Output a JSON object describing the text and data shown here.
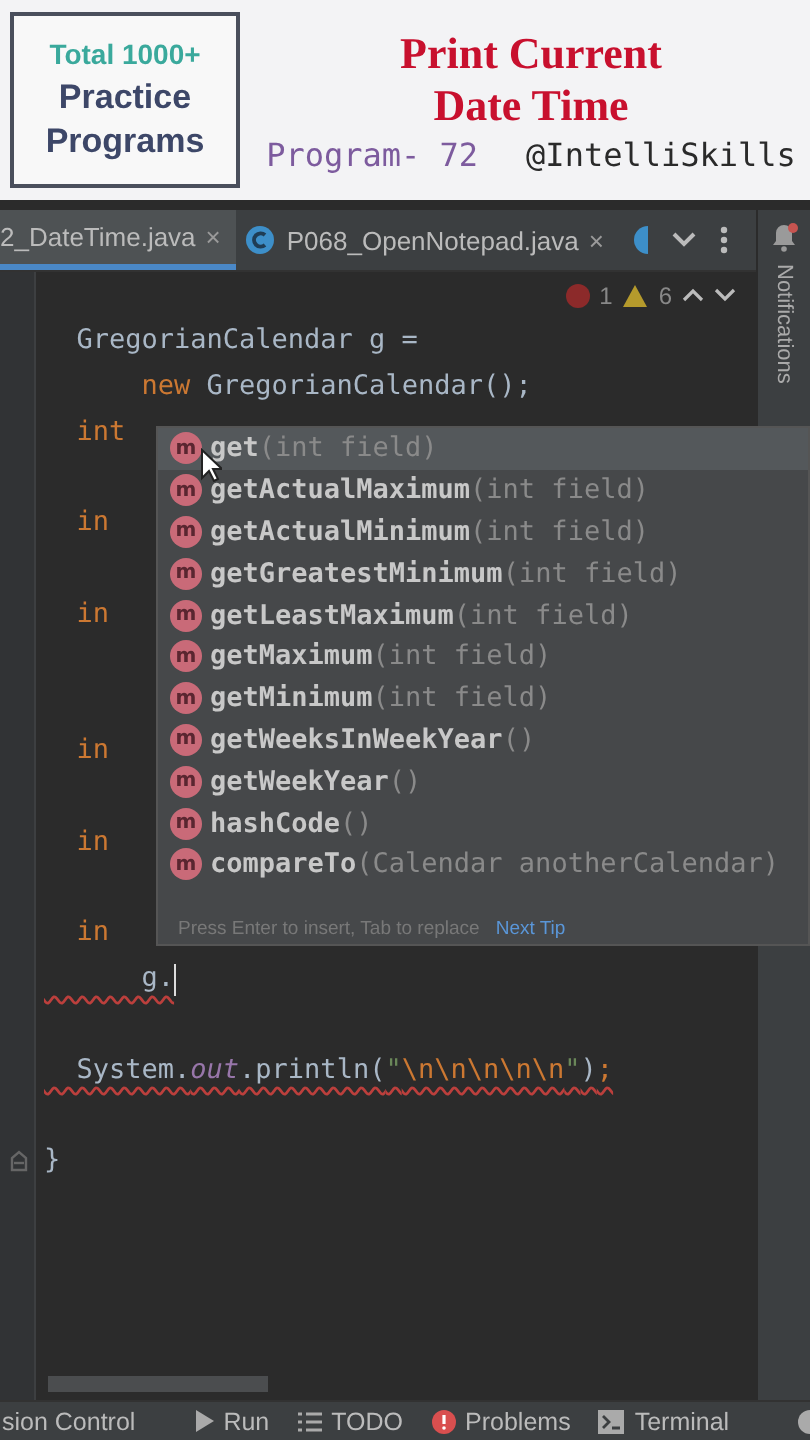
{
  "banner": {
    "box_lines": [
      "Total 1000+",
      "Practice",
      "Programs"
    ],
    "title_lines": [
      "Print Current",
      "Date Time"
    ],
    "program": "Program- 72",
    "handle": "@IntelliSkills"
  },
  "tabs": [
    {
      "label": "2_DateTime.java",
      "close": "×",
      "selected": true
    },
    {
      "label": "P068_OpenNotepad.java",
      "close": "×",
      "selected": false
    }
  ],
  "inspections": {
    "errors": "1",
    "warnings": "6"
  },
  "notifications": {
    "label": "Notifications"
  },
  "code_lines": [
    {
      "kind": "code",
      "segments": [
        {
          "kind": "plain",
          "text": "  GregorianCalendar g ="
        }
      ]
    },
    {
      "kind": "code",
      "segments": [
        {
          "kind": "keyword",
          "text": "      new"
        },
        {
          "kind": "plain",
          "text": " GregorianCalendar();"
        }
      ]
    },
    {
      "kind": "code",
      "segments": [
        {
          "kind": "keyword",
          "text": "  int"
        }
      ]
    },
    {
      "kind": "blank"
    },
    {
      "kind": "code",
      "segments": [
        {
          "kind": "keyword",
          "text": "  in"
        }
      ]
    },
    {
      "kind": "blank"
    },
    {
      "kind": "code",
      "segments": [
        {
          "kind": "keyword",
          "text": "  in"
        }
      ]
    },
    {
      "kind": "blank"
    },
    {
      "kind": "blank"
    },
    {
      "kind": "code",
      "segments": [
        {
          "kind": "keyword",
          "text": "  in"
        }
      ]
    },
    {
      "kind": "blank"
    },
    {
      "kind": "code",
      "segments": [
        {
          "kind": "keyword",
          "text": "  in"
        }
      ]
    },
    {
      "kind": "blank"
    },
    {
      "kind": "code",
      "segments": [
        {
          "kind": "keyword",
          "text": "  in"
        }
      ]
    },
    {
      "kind": "code",
      "error": true,
      "caret": true,
      "segments": [
        {
          "kind": "plain",
          "text": "      g."
        }
      ]
    },
    {
      "kind": "blank"
    },
    {
      "kind": "code",
      "error": true,
      "segments": [
        {
          "kind": "plain",
          "text": "  System."
        },
        {
          "kind": "field",
          "text": "out"
        },
        {
          "kind": "plain",
          "text": ".println("
        },
        {
          "kind": "string",
          "text": "\""
        },
        {
          "kind": "escape",
          "text": "\\n\\n\\n\\n\\n"
        },
        {
          "kind": "string",
          "text": "\""
        },
        {
          "kind": "plain",
          "text": ")"
        },
        {
          "kind": "keyword",
          "text": ";"
        }
      ]
    },
    {
      "kind": "blank"
    },
    {
      "kind": "code",
      "fold_marker": true,
      "segments": [
        {
          "kind": "plain",
          "text": "}"
        }
      ]
    }
  ],
  "completion": {
    "items": [
      {
        "icon": "m",
        "name": "get",
        "params": "(int field)",
        "selected": true
      },
      {
        "icon": "m",
        "name": "getActualMaximum",
        "params": "(int field)",
        "selected": false
      },
      {
        "icon": "m",
        "name": "getActualMinimum",
        "params": "(int field)",
        "selected": false
      },
      {
        "icon": "m",
        "name": "getGreatestMinimum",
        "params": "(int field)",
        "selected": false
      },
      {
        "icon": "m",
        "name": "getLeastMaximum",
        "params": "(int field)",
        "selected": false
      },
      {
        "icon": "m",
        "name": "getMaximum",
        "params": "(int field)",
        "selected": false
      },
      {
        "icon": "m",
        "name": "getMinimum",
        "params": "(int field)",
        "selected": false
      },
      {
        "icon": "m",
        "name": "getWeeksInWeekYear",
        "params": "()",
        "selected": false
      },
      {
        "icon": "m",
        "name": "getWeekYear",
        "params": "()",
        "selected": false
      },
      {
        "icon": "m",
        "name": "hashCode",
        "params": "()",
        "selected": false
      },
      {
        "icon": "m",
        "name": "compareTo",
        "params": "(Calendar anotherCalendar)",
        "selected": false
      }
    ],
    "hint": "Press Enter to insert, Tab to replace",
    "tip_link": "Next Tip"
  },
  "status_bar": [
    {
      "kind": "text",
      "label": "sion Control"
    },
    {
      "kind": "run",
      "label": "Run"
    },
    {
      "kind": "todo",
      "label": "TODO"
    },
    {
      "kind": "problems",
      "label": "Problems"
    },
    {
      "kind": "terminal",
      "label": "Terminal"
    },
    {
      "kind": "partial"
    }
  ]
}
